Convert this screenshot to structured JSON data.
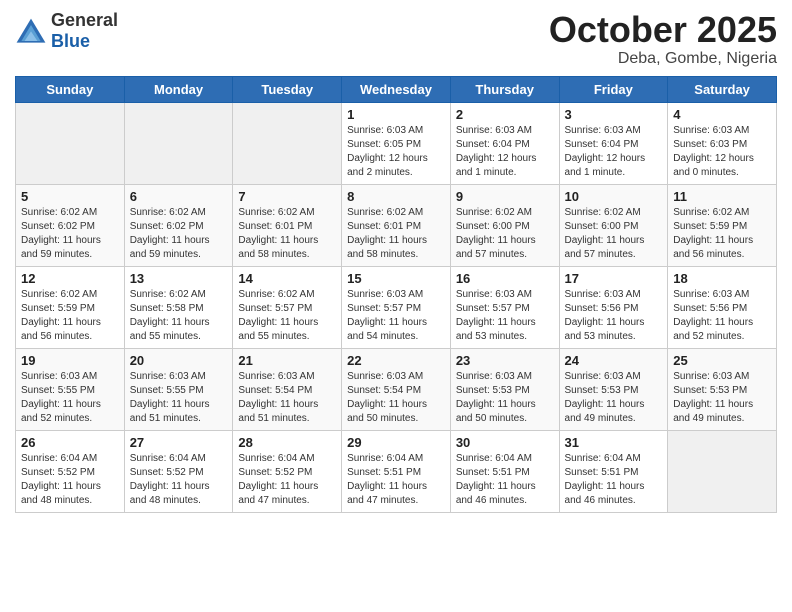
{
  "logo": {
    "general": "General",
    "blue": "Blue"
  },
  "header": {
    "month": "October 2025",
    "location": "Deba, Gombe, Nigeria"
  },
  "weekdays": [
    "Sunday",
    "Monday",
    "Tuesday",
    "Wednesday",
    "Thursday",
    "Friday",
    "Saturday"
  ],
  "weeks": [
    [
      {
        "day": "",
        "info": ""
      },
      {
        "day": "",
        "info": ""
      },
      {
        "day": "",
        "info": ""
      },
      {
        "day": "1",
        "info": "Sunrise: 6:03 AM\nSunset: 6:05 PM\nDaylight: 12 hours\nand 2 minutes."
      },
      {
        "day": "2",
        "info": "Sunrise: 6:03 AM\nSunset: 6:04 PM\nDaylight: 12 hours\nand 1 minute."
      },
      {
        "day": "3",
        "info": "Sunrise: 6:03 AM\nSunset: 6:04 PM\nDaylight: 12 hours\nand 1 minute."
      },
      {
        "day": "4",
        "info": "Sunrise: 6:03 AM\nSunset: 6:03 PM\nDaylight: 12 hours\nand 0 minutes."
      }
    ],
    [
      {
        "day": "5",
        "info": "Sunrise: 6:02 AM\nSunset: 6:02 PM\nDaylight: 11 hours\nand 59 minutes."
      },
      {
        "day": "6",
        "info": "Sunrise: 6:02 AM\nSunset: 6:02 PM\nDaylight: 11 hours\nand 59 minutes."
      },
      {
        "day": "7",
        "info": "Sunrise: 6:02 AM\nSunset: 6:01 PM\nDaylight: 11 hours\nand 58 minutes."
      },
      {
        "day": "8",
        "info": "Sunrise: 6:02 AM\nSunset: 6:01 PM\nDaylight: 11 hours\nand 58 minutes."
      },
      {
        "day": "9",
        "info": "Sunrise: 6:02 AM\nSunset: 6:00 PM\nDaylight: 11 hours\nand 57 minutes."
      },
      {
        "day": "10",
        "info": "Sunrise: 6:02 AM\nSunset: 6:00 PM\nDaylight: 11 hours\nand 57 minutes."
      },
      {
        "day": "11",
        "info": "Sunrise: 6:02 AM\nSunset: 5:59 PM\nDaylight: 11 hours\nand 56 minutes."
      }
    ],
    [
      {
        "day": "12",
        "info": "Sunrise: 6:02 AM\nSunset: 5:59 PM\nDaylight: 11 hours\nand 56 minutes."
      },
      {
        "day": "13",
        "info": "Sunrise: 6:02 AM\nSunset: 5:58 PM\nDaylight: 11 hours\nand 55 minutes."
      },
      {
        "day": "14",
        "info": "Sunrise: 6:02 AM\nSunset: 5:57 PM\nDaylight: 11 hours\nand 55 minutes."
      },
      {
        "day": "15",
        "info": "Sunrise: 6:03 AM\nSunset: 5:57 PM\nDaylight: 11 hours\nand 54 minutes."
      },
      {
        "day": "16",
        "info": "Sunrise: 6:03 AM\nSunset: 5:57 PM\nDaylight: 11 hours\nand 53 minutes."
      },
      {
        "day": "17",
        "info": "Sunrise: 6:03 AM\nSunset: 5:56 PM\nDaylight: 11 hours\nand 53 minutes."
      },
      {
        "day": "18",
        "info": "Sunrise: 6:03 AM\nSunset: 5:56 PM\nDaylight: 11 hours\nand 52 minutes."
      }
    ],
    [
      {
        "day": "19",
        "info": "Sunrise: 6:03 AM\nSunset: 5:55 PM\nDaylight: 11 hours\nand 52 minutes."
      },
      {
        "day": "20",
        "info": "Sunrise: 6:03 AM\nSunset: 5:55 PM\nDaylight: 11 hours\nand 51 minutes."
      },
      {
        "day": "21",
        "info": "Sunrise: 6:03 AM\nSunset: 5:54 PM\nDaylight: 11 hours\nand 51 minutes."
      },
      {
        "day": "22",
        "info": "Sunrise: 6:03 AM\nSunset: 5:54 PM\nDaylight: 11 hours\nand 50 minutes."
      },
      {
        "day": "23",
        "info": "Sunrise: 6:03 AM\nSunset: 5:53 PM\nDaylight: 11 hours\nand 50 minutes."
      },
      {
        "day": "24",
        "info": "Sunrise: 6:03 AM\nSunset: 5:53 PM\nDaylight: 11 hours\nand 49 minutes."
      },
      {
        "day": "25",
        "info": "Sunrise: 6:03 AM\nSunset: 5:53 PM\nDaylight: 11 hours\nand 49 minutes."
      }
    ],
    [
      {
        "day": "26",
        "info": "Sunrise: 6:04 AM\nSunset: 5:52 PM\nDaylight: 11 hours\nand 48 minutes."
      },
      {
        "day": "27",
        "info": "Sunrise: 6:04 AM\nSunset: 5:52 PM\nDaylight: 11 hours\nand 48 minutes."
      },
      {
        "day": "28",
        "info": "Sunrise: 6:04 AM\nSunset: 5:52 PM\nDaylight: 11 hours\nand 47 minutes."
      },
      {
        "day": "29",
        "info": "Sunrise: 6:04 AM\nSunset: 5:51 PM\nDaylight: 11 hours\nand 47 minutes."
      },
      {
        "day": "30",
        "info": "Sunrise: 6:04 AM\nSunset: 5:51 PM\nDaylight: 11 hours\nand 46 minutes."
      },
      {
        "day": "31",
        "info": "Sunrise: 6:04 AM\nSunset: 5:51 PM\nDaylight: 11 hours\nand 46 minutes."
      },
      {
        "day": "",
        "info": ""
      }
    ]
  ]
}
